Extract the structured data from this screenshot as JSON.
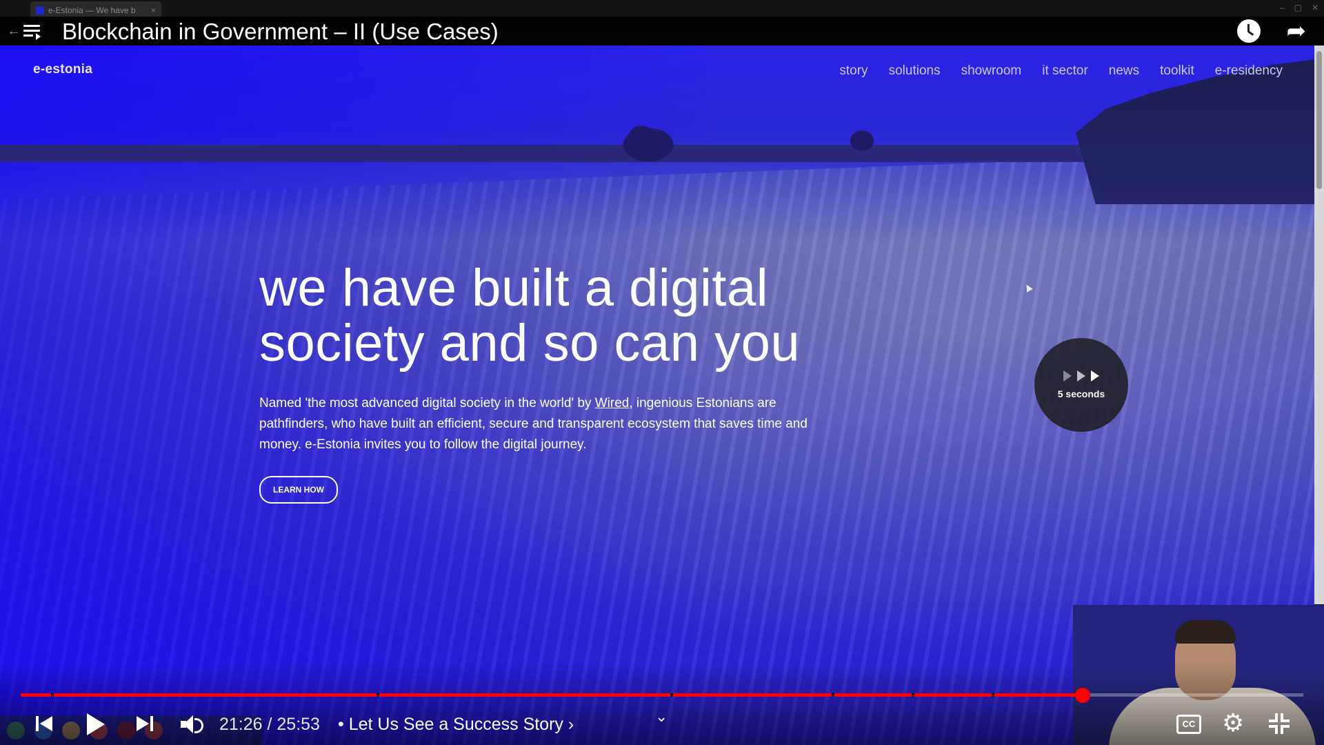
{
  "browser": {
    "tab_title": "e-Estonia — We have b",
    "tab_close": "×"
  },
  "player": {
    "title": "Blockchain in Government – II (Use Cases)",
    "time_display": "21:26 / 25:53",
    "chapter": "• Let Us See a Success Story ›",
    "progress_fraction": 0.828,
    "cc_label": "CC",
    "skip_label": "5 seconds"
  },
  "site": {
    "logo": "e-estonia",
    "nav": [
      "story",
      "solutions",
      "showroom",
      "it sector",
      "news",
      "toolkit",
      "e-residency"
    ],
    "hero_heading_line1": "we have built a digital",
    "hero_heading_line2": "society and so can you",
    "hero_body_prefix": "Named 'the most advanced digital society in the world' by ",
    "hero_body_link": "Wired",
    "hero_body_suffix": ", ingenious Estonians are pathfinders, who have built an efficient, secure and transparent ecosystem that saves time and money. e-Estonia invites you to follow the digital journey.",
    "learn_button": "LEARN HOW"
  },
  "colors": {
    "accent": "#ff0000",
    "overlay_blue": "#2b22e6"
  },
  "icons": [
    "playlist-icon",
    "watch-later-icon",
    "share-icon",
    "prev-icon",
    "play-icon",
    "next-icon",
    "volume-icon",
    "cc-icon",
    "settings-icon",
    "exit-fullscreen-icon"
  ]
}
